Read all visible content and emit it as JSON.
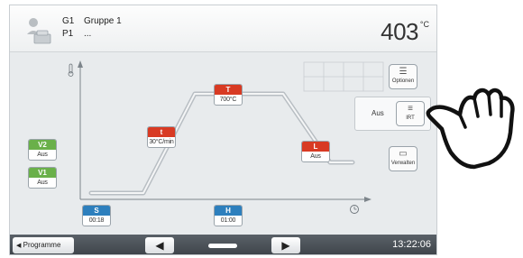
{
  "header": {
    "group_code": "G1",
    "group_name": "Gruppe 1",
    "program_code": "P1",
    "program_name": "...",
    "temperature": "403",
    "temperature_unit": "°C"
  },
  "program": {
    "closing_time": {
      "tag": "S",
      "value": "00:18"
    },
    "heat_rate": {
      "tag": "t",
      "value": "30°C/min"
    },
    "holding_temp": {
      "tag": "T",
      "value": "700°C"
    },
    "holding_time": {
      "tag": "H",
      "value": "01:00"
    },
    "long_term_cooling": {
      "tag": "L",
      "value": "Aus"
    },
    "vacuum_1": {
      "tag": "V1",
      "value": "Aus"
    },
    "vacuum_2": {
      "tag": "V2",
      "value": "Aus"
    }
  },
  "side_panel": {
    "options_label": "Optionen",
    "irt_label": "IRT",
    "irt_status": "Aus",
    "manage_label": "Verwalten"
  },
  "footer": {
    "programs_label": "Programme",
    "time": "13:22:06"
  },
  "colors": {
    "red_tag": "#d83a23",
    "green_tag": "#6ab04a",
    "blue_tag": "#2d7fbd",
    "curve": "#b8bec3"
  }
}
